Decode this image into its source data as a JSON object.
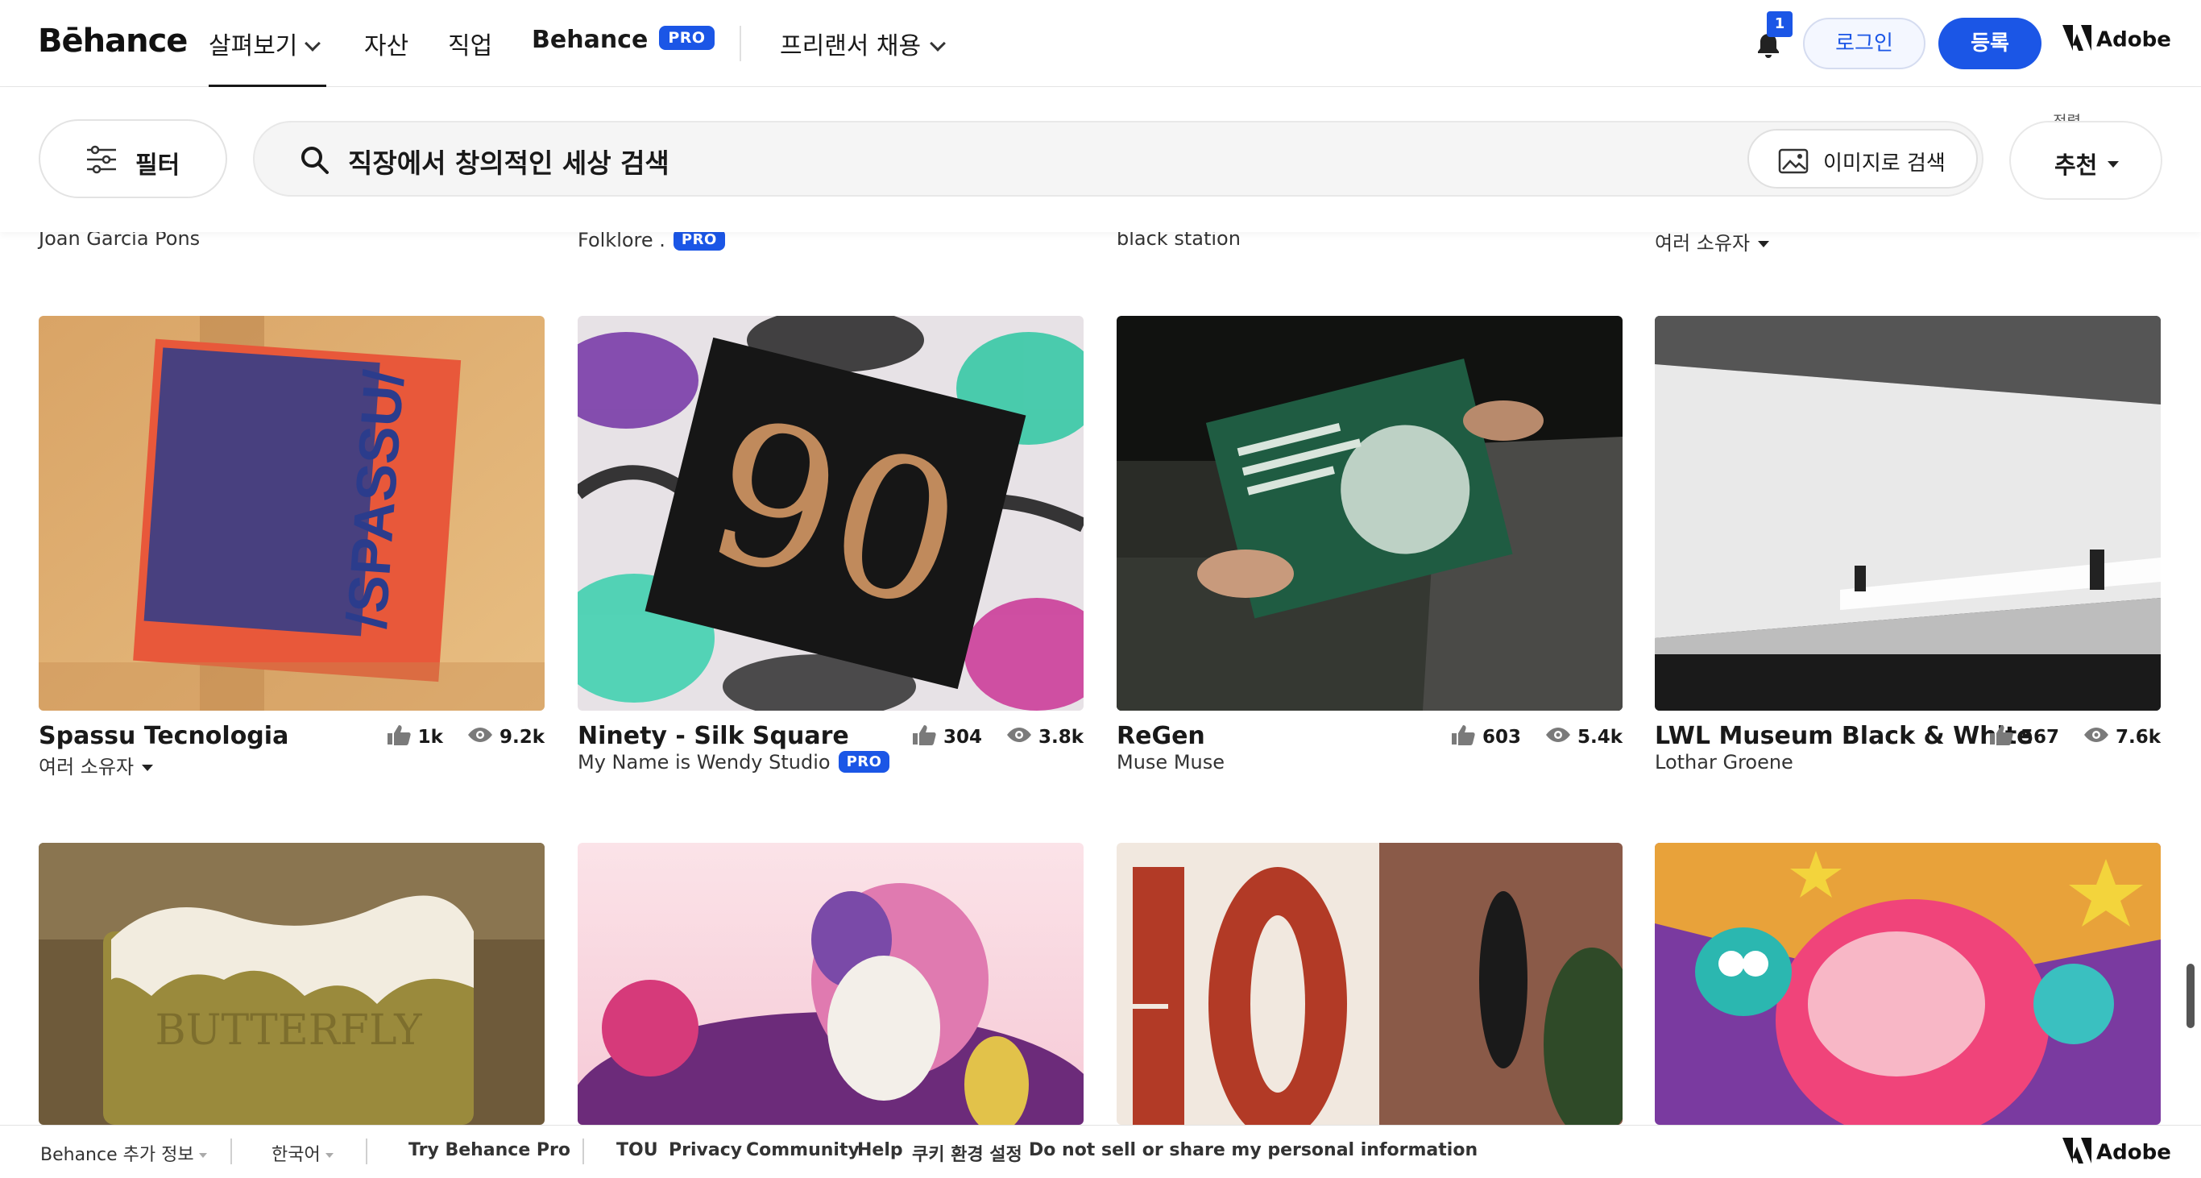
{
  "brand": {
    "logo": "Bēhance",
    "accent": "#1b56e6"
  },
  "nav": {
    "browse": "살펴보기",
    "assets": "자산",
    "jobs": "직업",
    "behance": "Behance",
    "pro": "PRO",
    "freelance": "프리랜서 채용",
    "notifications_count": "1",
    "login": "로그인",
    "signup": "등록",
    "adobe": "Adobe"
  },
  "search": {
    "filter": "필터",
    "placeholder": "직장에서 창의적인 세상 검색",
    "image_search": "이미지로 검색",
    "sort_label": "정렬",
    "sort_value": "추천"
  },
  "previous_row_owners": [
    {
      "name": "Joan García Pons",
      "pro": false,
      "multi": false
    },
    {
      "name": "Folklore .",
      "pro": true,
      "multi": false
    },
    {
      "name": "black station",
      "pro": false,
      "multi": false
    },
    {
      "name": "여러 소유자",
      "pro": false,
      "multi": true
    }
  ],
  "projects": [
    {
      "title": "Spassu Tecnologia",
      "owner": "여러 소유자",
      "owner_pro": false,
      "multi_owner": true,
      "likes": "1k",
      "views": "9.2k",
      "image": "orange book mockup on wooden table"
    },
    {
      "title": "Ninety - Silk Square",
      "owner": "My Name is Wendy Studio",
      "owner_pro": true,
      "multi_owner": false,
      "likes": "304",
      "views": "3.8k",
      "image": "black square box with gold 90 on tropical pattern"
    },
    {
      "title": "ReGen",
      "owner": "Muse Muse",
      "owner_pro": false,
      "multi_owner": false,
      "likes": "603",
      "views": "5.4k",
      "image": "hands holding green book"
    },
    {
      "title": "LWL Museum Black & White",
      "owner": "Lothar Groene",
      "owner_pro": false,
      "multi_owner": false,
      "likes": "567",
      "views": "7.6k",
      "image": "black and white museum architecture"
    }
  ],
  "next_row_images": [
    "butter soap bar with foam",
    "colorful family illustration",
    "red number 10 and brick wall",
    "vivid character illustration"
  ],
  "footer": {
    "more_info": "Behance 추가 정보",
    "language": "한국어",
    "try_pro": "Try Behance Pro",
    "tou": "TOU",
    "privacy": "Privacy",
    "community": "Community",
    "help": "Help",
    "cookie": "쿠키 환경 설정",
    "do_not_sell": "Do not sell or share my personal information",
    "adobe": "Adobe"
  }
}
